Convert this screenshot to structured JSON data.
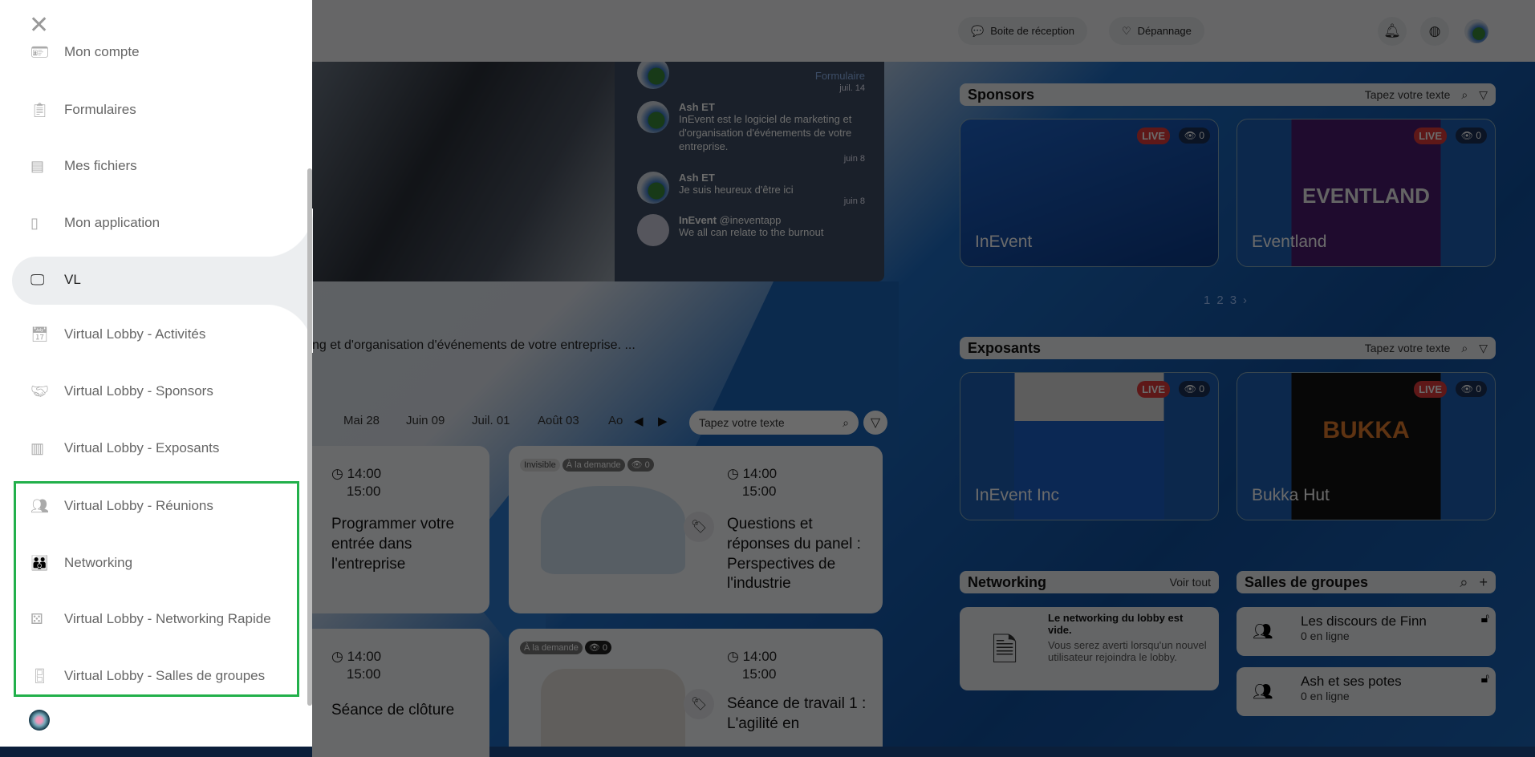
{
  "header": {
    "inbox": "Boite de réception",
    "troubleshoot": "Dépannage"
  },
  "chat": {
    "messages": [
      {
        "name": "",
        "text": "Formulaire",
        "date": "juil. 14"
      },
      {
        "name": "Ash ET",
        "text": "InEvent est le logiciel de marketing et d'organisation d'événements de votre entreprise.",
        "date": "juin 8"
      },
      {
        "name": "Ash ET",
        "text": "Je suis heureux d'être ici",
        "date": "juin 8"
      },
      {
        "name": "InEvent",
        "handle": "@ineventapp",
        "text": "We all can relate to the burnout",
        "date": ""
      }
    ]
  },
  "description": "ng et d'organisation d'événements de votre entreprise.  ...",
  "dates": [
    "Mai 28",
    "Juin 09",
    "Juil. 01",
    "Août 03",
    "Ao"
  ],
  "search_placeholder": "Tapez votre texte",
  "activities": [
    {
      "start": "14:00",
      "end": "15:00",
      "title": "Programmer votre entrée dans l'entreprise"
    },
    {
      "start": "14:00",
      "end": "15:00",
      "title": "Questions et réponses du panel : Perspectives de l'industrie",
      "badges": [
        "Invisible",
        "À la demande"
      ],
      "views": "0"
    },
    {
      "start": "14:00",
      "end": "15:00",
      "title": "Séance de clôture"
    },
    {
      "start": "14:00",
      "end": "15:00",
      "title": "Séance de travail 1 : L'agilité en",
      "badges": [
        "À la demande"
      ],
      "views": "0"
    }
  ],
  "sponsors": {
    "title": "Sponsors",
    "items": [
      {
        "name": "InEvent",
        "live": "LIVE",
        "views": "0"
      },
      {
        "name": "Eventland",
        "logo": "EVENTLAND",
        "live": "LIVE",
        "views": "0"
      }
    ],
    "pages": [
      "1",
      "2",
      "3"
    ]
  },
  "exhibitors": {
    "title": "Exposants",
    "items": [
      {
        "name": "InEvent Inc",
        "live": "LIVE",
        "views": "0"
      },
      {
        "name": "Bukka Hut",
        "logo": "BUKKA HUT",
        "live": "LIVE",
        "views": "0"
      }
    ]
  },
  "networking": {
    "title": "Networking",
    "see_all": "Voir tout",
    "empty_title": "Le networking du lobby est vide.",
    "empty_text": "Vous serez averti lorsqu'un nouvel utilisateur rejoindra le lobby."
  },
  "rooms": {
    "title": "Salles de groupes",
    "items": [
      {
        "name": "Les discours de Finn",
        "online": "0 en ligne"
      },
      {
        "name": "Ash et ses potes",
        "online": "0 en ligne"
      }
    ]
  },
  "sidebar": {
    "items": [
      {
        "label": "Mon compte",
        "icon": "id-card-icon"
      },
      {
        "label": "Formulaires",
        "icon": "clipboard-icon"
      },
      {
        "label": "Mes fichiers",
        "icon": "table-icon"
      },
      {
        "label": "Mon application",
        "icon": "mobile-icon"
      },
      {
        "label": "VL",
        "icon": "monitor-icon",
        "active": true
      },
      {
        "label": "Virtual Lobby - Activités",
        "icon": "calendar-icon"
      },
      {
        "label": "Virtual Lobby - Sponsors",
        "icon": "handshake-icon"
      },
      {
        "label": "Virtual Lobby - Exposants",
        "icon": "booth-icon"
      },
      {
        "label": "Virtual Lobby - Réunions",
        "icon": "users-icon"
      },
      {
        "label": "Networking",
        "icon": "group-icon"
      },
      {
        "label": "Virtual Lobby - Networking Rapide",
        "icon": "dice-icon"
      },
      {
        "label": "Virtual Lobby - Salles de groupes",
        "icon": "door-icon"
      }
    ]
  },
  "colors": {
    "highlight": "#22b04b",
    "live": "#e03a3a"
  }
}
